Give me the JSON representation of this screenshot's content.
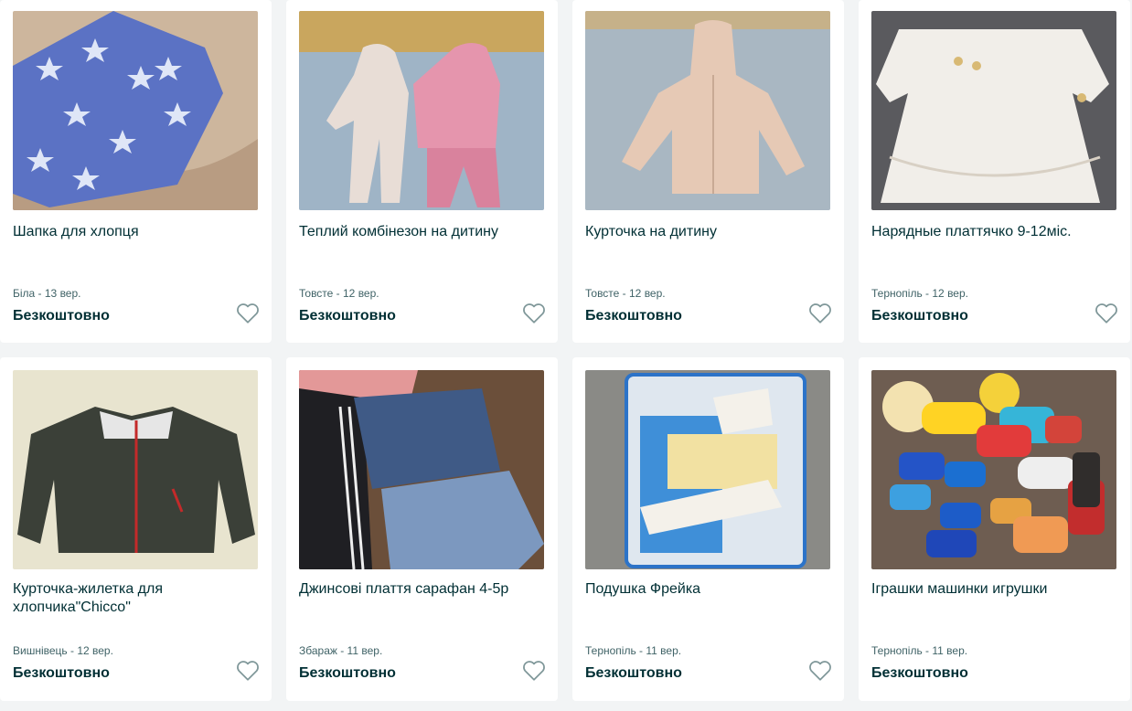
{
  "listings": [
    {
      "title": "Шапка для хлопця",
      "location_date": "Біла - 13 вер.",
      "price": "Безкоштовно"
    },
    {
      "title": "Теплий комбінезон на дитину",
      "location_date": "Товсте - 12 вер.",
      "price": "Безкоштовно"
    },
    {
      "title": "Курточка на дитину",
      "location_date": "Товсте - 12 вер.",
      "price": "Безкоштовно"
    },
    {
      "title": "Нарядные платтячко 9-12міс.",
      "location_date": "Тернопіль - 12 вер.",
      "price": "Безкоштовно"
    },
    {
      "title": "Курточка-жилетка для хлопчика\"Chicco\"",
      "location_date": "Вишнівець - 12 вер.",
      "price": "Безкоштовно"
    },
    {
      "title": "Джинсові плаття сарафан 4-5р",
      "location_date": "Збараж - 11 вер.",
      "price": "Безкоштовно"
    },
    {
      "title": "Подушка Фрейка",
      "location_date": "Тернопіль - 11 вер.",
      "price": "Безкоштовно"
    },
    {
      "title": "Іграшки машинки игрушки",
      "location_date": "Тернопіль - 11 вер.",
      "price": "Безкоштовно"
    }
  ],
  "icons": {
    "favorite": "heart-outline-icon"
  },
  "colors": {
    "text": "#002f34",
    "meta": "#406367",
    "background": "#f2f4f5"
  }
}
